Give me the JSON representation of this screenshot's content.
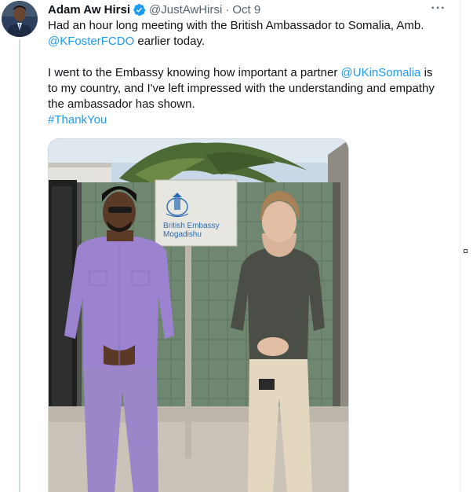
{
  "tweet": {
    "display_name": "Adam Aw Hirsi",
    "handle": "@JustAwHirsi",
    "separator": "·",
    "timestamp": "Oct 9",
    "more_label": "···",
    "line1": "Had an hour long meeting with the British Ambassador to Somalia, Amb.",
    "mention_fcdo": "@KFosterFCDO",
    "line2_rest": " earlier today.",
    "line3_pre": "I went to the Embassy knowing how important a partner ",
    "mention_uk": "@UKinSomalia",
    "line3_post": " is",
    "line4": "to my country, and I've left impressed with the understanding and empathy",
    "line5": "the ambassador has shown.",
    "hashtag": "#ThankYou"
  },
  "media": {
    "sign_line1": "British Embassy",
    "sign_line2": "Mogadishu"
  },
  "icons": {
    "verified": "verified-badge-icon",
    "more": "more-options-icon"
  },
  "colors": {
    "link": "#1d9bf0",
    "text": "#0f1419",
    "muted": "#536471"
  }
}
